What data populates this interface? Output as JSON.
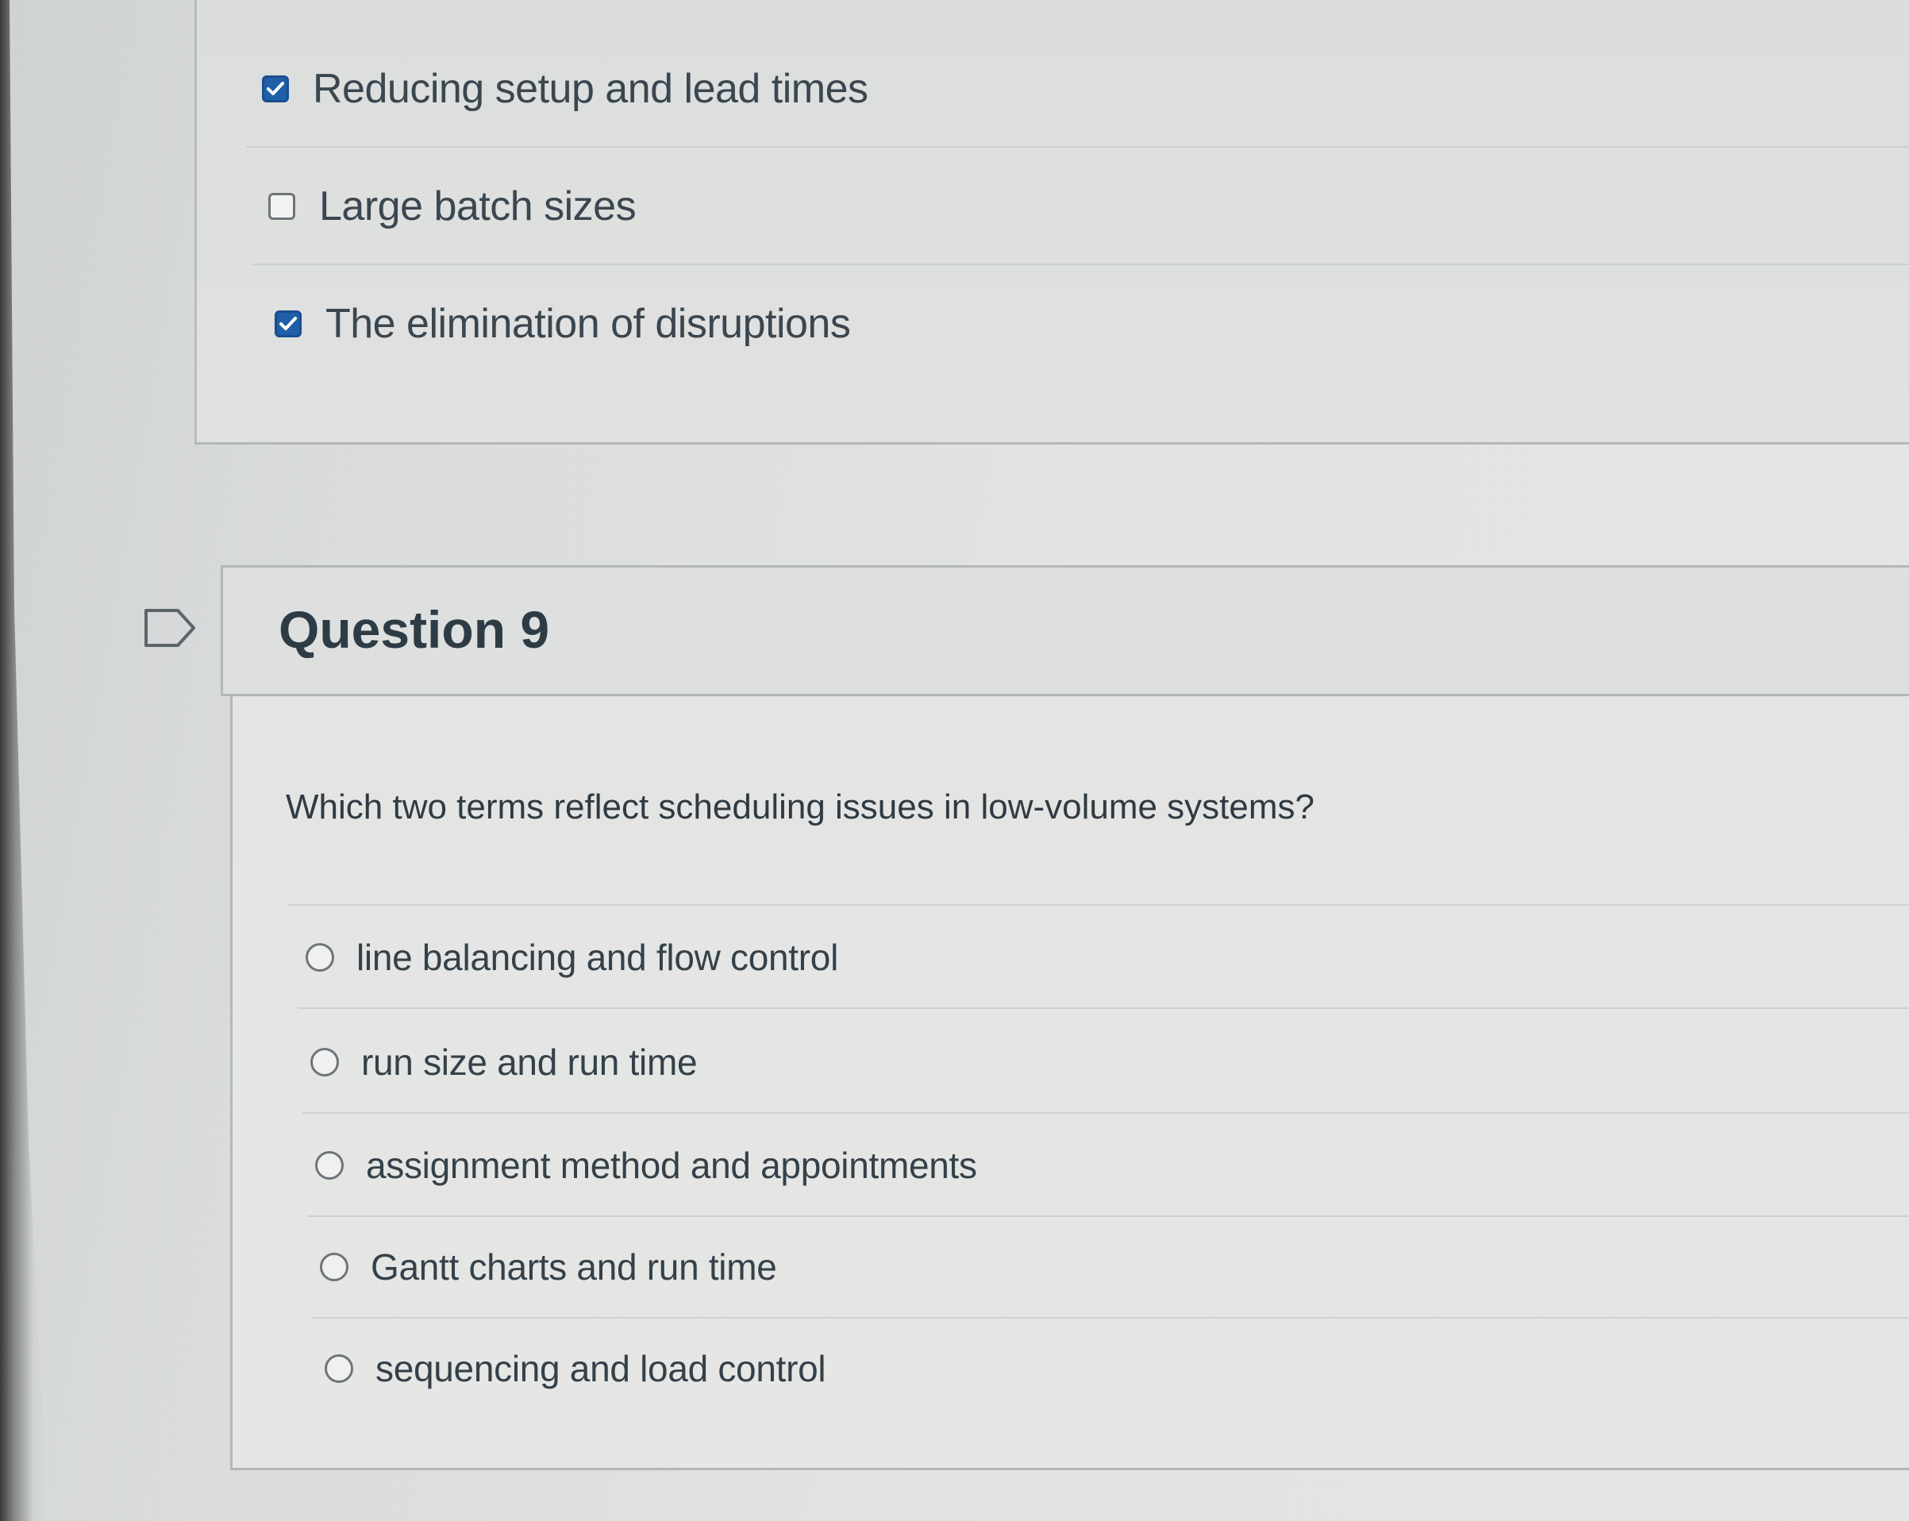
{
  "question8": {
    "options": [
      {
        "label": "Reducing setup and lead times",
        "checked": true
      },
      {
        "label": "Large batch sizes",
        "checked": false
      },
      {
        "label": "The elimination of disruptions",
        "checked": true
      }
    ]
  },
  "question9": {
    "title": "Question 9",
    "prompt": "Which two terms reflect scheduling issues in low-volume systems?",
    "options": [
      {
        "label": "line balancing and flow control",
        "selected": false
      },
      {
        "label": "run size and run time",
        "selected": false
      },
      {
        "label": "assignment method and appointments",
        "selected": false
      },
      {
        "label": "Gantt charts and run time",
        "selected": false
      },
      {
        "label": "sequencing and load control",
        "selected": false
      }
    ]
  },
  "colors": {
    "checkbox_checked": "#1f5fa8",
    "text": "#2d3b45",
    "border": "#b3b7b9"
  },
  "icons": {
    "checked": "checkmark-icon",
    "flag": "flag-question-icon"
  }
}
